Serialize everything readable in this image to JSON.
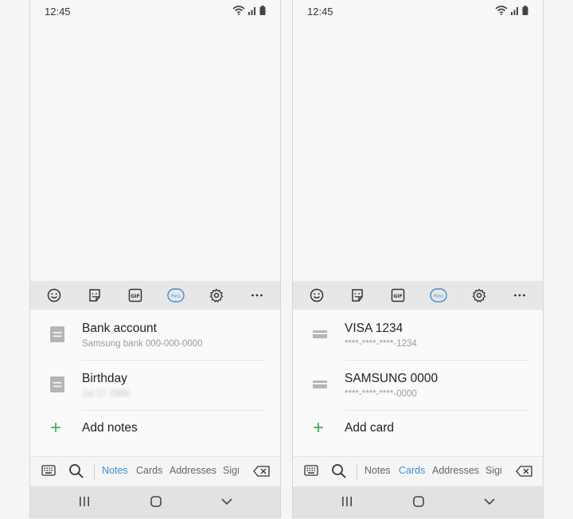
{
  "screens": [
    {
      "status": {
        "time": "12:45"
      },
      "toolbar": {
        "icons": [
          "emoji-icon",
          "sticker-icon",
          "gif-icon",
          "samsung-pass-icon",
          "settings-icon",
          "more-icon"
        ],
        "gif_text": "GIF",
        "pass_text": "Pass"
      },
      "items": [
        {
          "title": "Bank account",
          "subtitle": "Samsung bank 000-000-0000",
          "icon": "note-icon",
          "subtitle_blurred": false
        },
        {
          "title": "Birthday",
          "subtitle": "Jul 27 1995",
          "icon": "note-icon",
          "subtitle_blurred": true
        }
      ],
      "add_label": "Add notes",
      "tabs": [
        "Notes",
        "Cards",
        "Addresses",
        "Sign-"
      ],
      "active_tab": "Notes"
    },
    {
      "status": {
        "time": "12:45"
      },
      "toolbar": {
        "icons": [
          "emoji-icon",
          "sticker-icon",
          "gif-icon",
          "samsung-pass-icon",
          "settings-icon",
          "more-icon"
        ],
        "gif_text": "GIF",
        "pass_text": "Pass"
      },
      "items": [
        {
          "title": "VISA 1234",
          "subtitle": "****-****-****-1234",
          "icon": "card-icon",
          "subtitle_blurred": false
        },
        {
          "title": "SAMSUNG 0000",
          "subtitle": "****-****-****-0000",
          "icon": "card-icon",
          "subtitle_blurred": false
        }
      ],
      "add_label": "Add card",
      "tabs": [
        "Notes",
        "Cards",
        "Addresses",
        "Sign-"
      ],
      "active_tab": "Cards"
    }
  ],
  "colors": {
    "accent": "#3d8fd6",
    "add_green": "#3fae5b",
    "icon_gray": "#b5b5b5"
  }
}
